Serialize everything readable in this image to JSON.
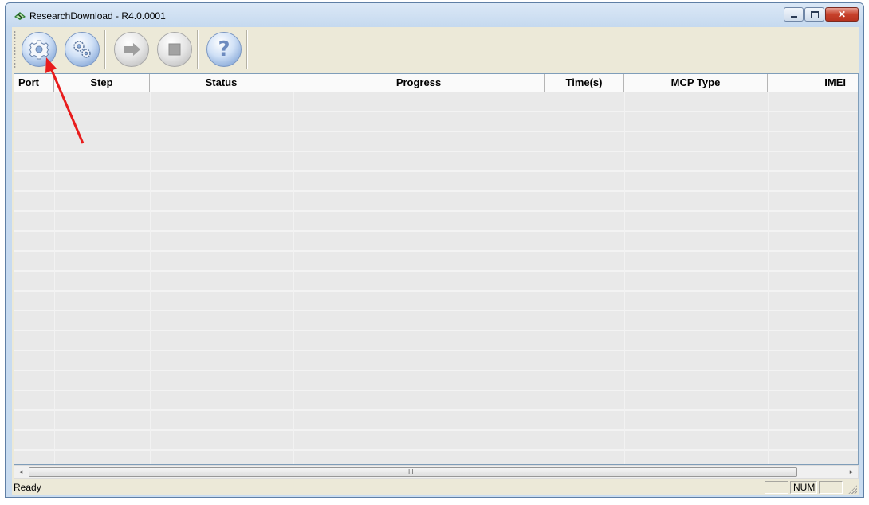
{
  "window": {
    "title": "ResearchDownload - R4.0.0001",
    "app_icon": "research-download-icon",
    "controls": [
      "minimize-icon",
      "maximize-icon",
      "close-icon"
    ]
  },
  "toolbar": {
    "buttons": [
      {
        "name": "load-packet-button",
        "icon": "gear-icon",
        "state": "enabled"
      },
      {
        "name": "settings-button",
        "icon": "gears-icon",
        "state": "enabled"
      },
      {
        "name": "start-download-button",
        "icon": "play-arrow-icon",
        "state": "disabled"
      },
      {
        "name": "stop-download-button",
        "icon": "stop-icon",
        "state": "disabled"
      },
      {
        "name": "help-button",
        "icon": "help-icon",
        "glyph": "?",
        "state": "enabled"
      }
    ]
  },
  "grid": {
    "columns": [
      "Port",
      "Step",
      "Status",
      "Progress",
      "Time(s)",
      "MCP Type",
      "IMEI"
    ],
    "rows": []
  },
  "scrollbar": {
    "left_arrow": "◂",
    "right_arrow": "▸",
    "thumb_grip": "III"
  },
  "statusbar": {
    "text": "Ready",
    "panes": [
      "",
      "NUM",
      ""
    ]
  },
  "annotation": {
    "type": "arrow",
    "color": "#e81c1c",
    "target": "load-packet-button"
  },
  "colors": {
    "window_frame": "#c9dcf0",
    "client_bg": "#ece9d8",
    "grid_bg": "#e8e8e8",
    "button_blue": "#8eaedb"
  }
}
